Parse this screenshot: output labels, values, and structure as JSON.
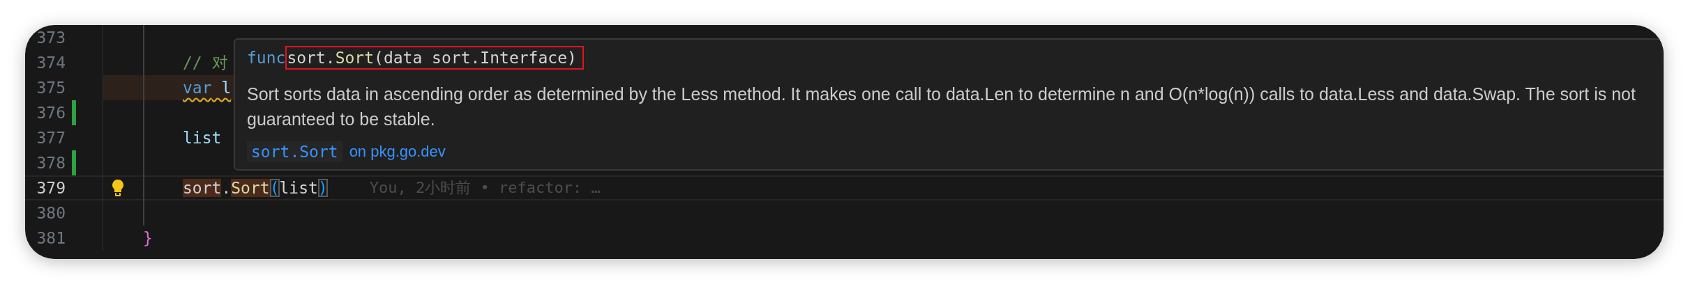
{
  "editor": {
    "lines": [
      {
        "number": "373",
        "guide": true,
        "added": false,
        "highlighted": false,
        "current": false,
        "lightbulb": false,
        "warning": false
      },
      {
        "number": "374",
        "code": [
          {
            "text": "// 对",
            "kind": "comment"
          }
        ],
        "guide": true,
        "added": false,
        "highlighted": false,
        "current": false,
        "lightbulb": false,
        "warning": false
      },
      {
        "number": "375",
        "code": [
          {
            "text": "var",
            "kind": "keyword"
          },
          {
            "text": " l",
            "kind": "identifier"
          }
        ],
        "guide": true,
        "added": false,
        "highlighted": true,
        "current": false,
        "lightbulb": false,
        "warning": true
      },
      {
        "number": "376",
        "guide": true,
        "added": true,
        "highlighted": false,
        "current": false,
        "lightbulb": false,
        "warning": false
      },
      {
        "number": "377",
        "code": [
          {
            "text": "list",
            "kind": "identifier"
          }
        ],
        "guide": true,
        "added": false,
        "highlighted": false,
        "current": false,
        "lightbulb": false,
        "warning": false
      },
      {
        "number": "378",
        "guide": true,
        "added": true,
        "highlighted": false,
        "current": false,
        "lightbulb": false,
        "warning": false
      },
      {
        "number": "379",
        "code": [
          {
            "text": "sort",
            "kind": "package-match"
          },
          {
            "text": ".",
            "kind": "plain"
          },
          {
            "text": "Sort",
            "kind": "function-match"
          },
          {
            "text": "(",
            "kind": "bracket-match"
          },
          {
            "text": "list",
            "kind": "plain"
          },
          {
            "text": ")",
            "kind": "bracket-match"
          }
        ],
        "blame": "You, 2小时前 • refactor: …",
        "guide": true,
        "added": false,
        "highlighted": false,
        "current": true,
        "lightbulb": true,
        "warning": false
      },
      {
        "number": "380",
        "guide": true,
        "added": false,
        "highlighted": false,
        "current": false,
        "lightbulb": false,
        "warning": false
      },
      {
        "number": "381",
        "code": [
          {
            "text": "}",
            "kind": "brace"
          }
        ],
        "guide": false,
        "added": false,
        "highlighted": false,
        "current": false,
        "lightbulb": false,
        "warning": false
      }
    ]
  },
  "hover": {
    "keyword": "func",
    "boxed": true,
    "signature": [
      {
        "text": " sort.",
        "kind": "plain"
      },
      {
        "text": "Sort",
        "kind": "function"
      },
      {
        "text": "(data sort.Interface)",
        "kind": "plain"
      }
    ],
    "description": "Sort sorts data in ascending order as determined by the Less method. It makes one call to data.Len to determine n and O(n*log(n)) calls to data.Less and data.Swap. The sort is not guaranteed to be stable.",
    "symbol": "sort.Sort",
    "source_link": "on pkg.go.dev"
  }
}
